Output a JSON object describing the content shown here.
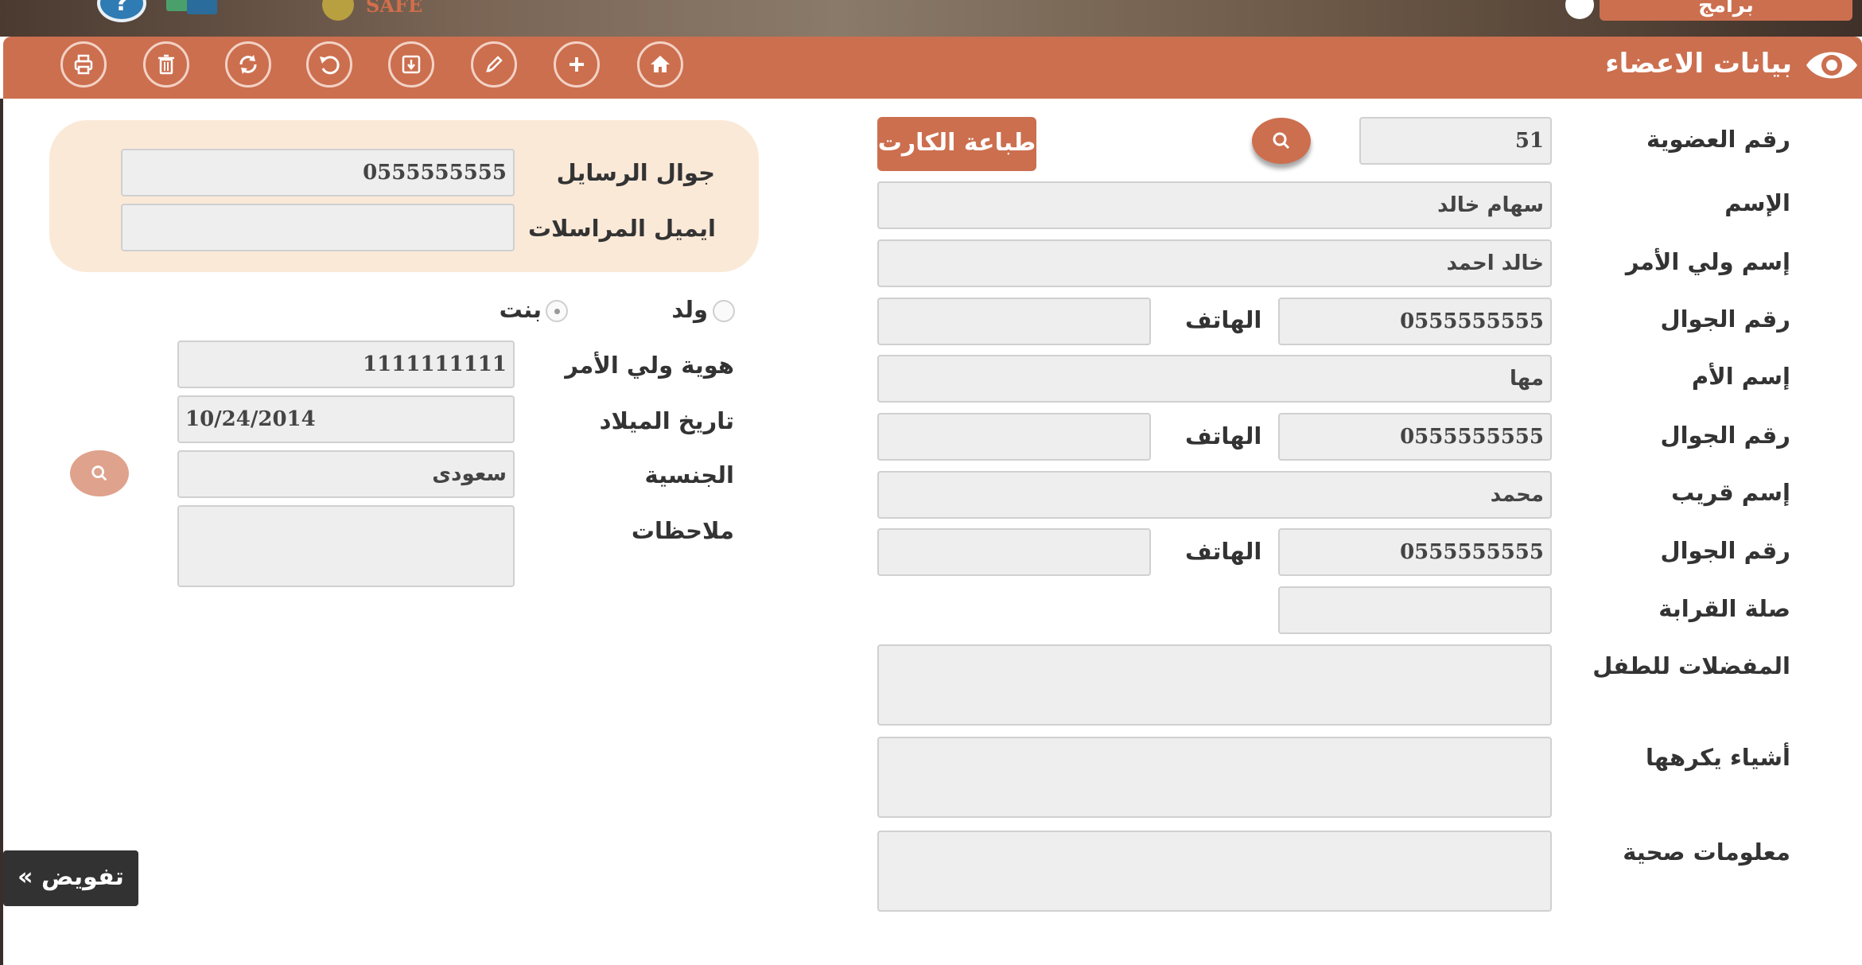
{
  "top": {
    "program_button": "برامج",
    "help_glyph": "?",
    "logo_text": "SAFE"
  },
  "header": {
    "title": "بيانات الاعضاء",
    "eye_icon": "eye-icon"
  },
  "toolbar": {
    "icons": [
      "home-icon",
      "add-icon",
      "edit-icon",
      "save-icon",
      "undo-icon",
      "refresh-icon",
      "delete-icon",
      "print-icon"
    ]
  },
  "form": {
    "membership_no_label": "رقم العضوية",
    "membership_no": "51",
    "print_card": "طباعة الكارت",
    "name_label": "الإسم",
    "name": "سهام خالد",
    "guardian_name_label": "إسم ولي الأمر",
    "guardian_name": "خالد احمد",
    "mobile_label": "رقم الجوال",
    "phone_label": "الهاتف",
    "guardian_mobile": "0555555555",
    "guardian_phone": "",
    "mother_name_label": "إسم الأم",
    "mother_name": "مها",
    "mother_mobile": "0555555555",
    "mother_phone": "",
    "relative_name_label": "إسم قريب",
    "relative_name": "محمد",
    "relative_mobile": "0555555555",
    "relative_phone": "",
    "relation_label": "صلة القرابة",
    "relation": "",
    "favorites_label": "المفضلات للطفل",
    "favorites": "",
    "dislikes_label": "أشياء يكرهها",
    "dislikes": "",
    "health_label": "معلومات صحية",
    "health": "",
    "messages_mobile_label": "جوال الرسايل",
    "messages_mobile": "0555555555",
    "messages_email_label": "ايميل المراسلات",
    "messages_email": "",
    "boy_label": "ولد",
    "girl_label": "بنت",
    "gender_selected": "بنت",
    "guardian_id_label": "هوية ولي الأمر",
    "guardian_id": "1111111111",
    "birth_date_label": "تاريخ الميلاد",
    "birth_date": "10/24/2014",
    "nationality_label": "الجنسية",
    "nationality": "سعودى",
    "notes_label": "ملاحظات",
    "notes": ""
  },
  "footer": {
    "delegate_button": "« تفويض"
  },
  "colors": {
    "accent": "#cc6f4f",
    "panel": "#fbe9d8",
    "input_bg": "#eeeeee",
    "dark_button": "#323232"
  }
}
